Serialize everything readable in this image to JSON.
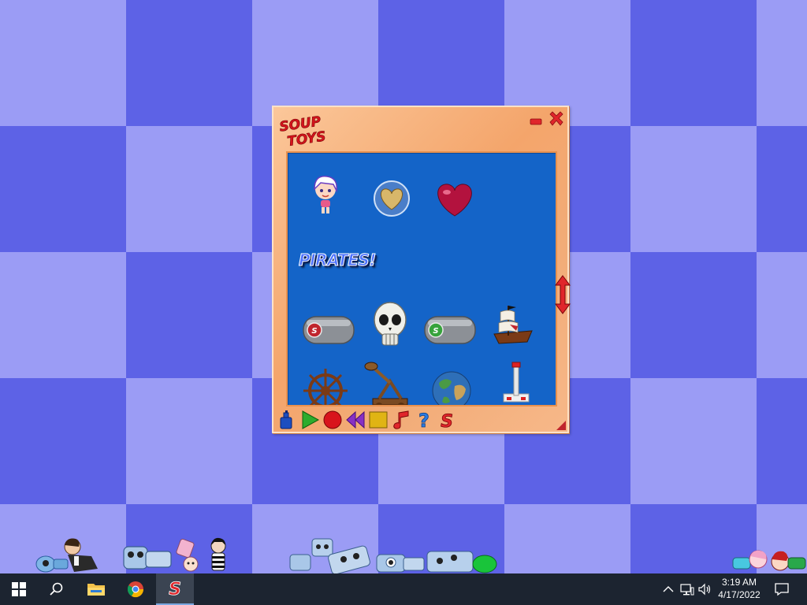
{
  "app": {
    "logo_line1": "SOUP",
    "logo_line2": "TOYS",
    "section_label": "PIRATES!",
    "colors": {
      "window_frame": "#f4a56b",
      "palette_bg": "#1464c8",
      "close_red": "#e0262b",
      "desktop_light": "#9b9cf5",
      "desktop_dark": "#5d62e6"
    }
  },
  "palette": {
    "row1": [
      "girl-toy-icon",
      "gold-heart-toy-icon",
      "red-heart-toy-icon"
    ],
    "row2": [
      "red-cannon-toy-icon",
      "skull-toy-icon",
      "green-cannon-toy-icon",
      "pirate-ship-toy-icon"
    ],
    "row3": [
      "ship-wheel-toy-icon",
      "catapult-toy-icon",
      "globe-toy-icon",
      "lever-toy-icon"
    ]
  },
  "toolbar": {
    "items": [
      "spray-can-icon",
      "play-icon",
      "record-icon",
      "rewind-icon",
      "stop-icon",
      "music-icon",
      "help-icon",
      "soup-logo-icon"
    ]
  },
  "taskbar": {
    "icons": [
      "windows-start-icon",
      "search-icon",
      "file-explorer-icon",
      "chrome-icon",
      "soup-toys-app-icon"
    ],
    "tray_icons": [
      "chevron-up-icon",
      "network-icon",
      "volume-icon",
      "notification-icon"
    ],
    "time": "3:19 AM",
    "date": "4/17/2022"
  }
}
